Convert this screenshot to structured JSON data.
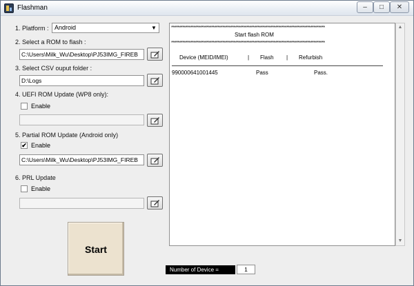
{
  "window": {
    "title": "Flashman"
  },
  "title_buttons": {
    "minimize": "–",
    "maximize": "□",
    "close": "✕"
  },
  "form": {
    "platform": {
      "label": "1. Platform :",
      "value": "Android"
    },
    "rom": {
      "label": "2. Select a ROM to flash :",
      "path": "C:\\Users\\Milk_Wu\\Desktop\\PJ53IMG_FIREB"
    },
    "csv": {
      "label": "3. Select CSV ouput folder :",
      "path": "D:\\Logs"
    },
    "uefi": {
      "label": "4. UEFI ROM Update (WP8 only):",
      "enable_label": "Enable",
      "enabled": false,
      "path": ""
    },
    "partial": {
      "label": "5. Partial ROM Update (Android only)",
      "enable_label": "Enable",
      "enabled": true,
      "path": "C:\\Users\\Milk_Wu\\Desktop\\PJ53IMG_FIREB"
    },
    "prl": {
      "label": "6. PRL Update",
      "enable_label": "Enable",
      "enabled": false,
      "path": ""
    }
  },
  "start_button": {
    "label": "Start"
  },
  "log": {
    "stars": "************************************************************************************************",
    "heading": "Start flash ROM",
    "columns": [
      "Device (MEID/IMEI)",
      "|",
      "Flash",
      "|",
      "Refurbish"
    ],
    "rows": [
      {
        "device": "990000641001445",
        "flash": "Pass",
        "refurbish": "Pass."
      }
    ]
  },
  "device_count": {
    "label": "Number of Device =",
    "value": "1"
  },
  "icons": {
    "browse": "folder-edit-icon",
    "check": "✔",
    "dropdown": "▼"
  }
}
